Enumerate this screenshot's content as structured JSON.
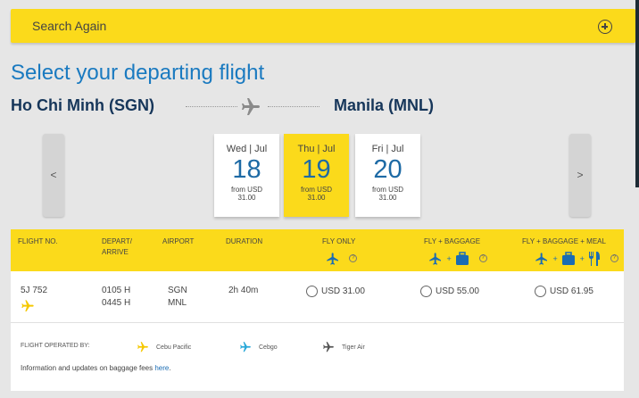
{
  "search": {
    "label": "Search Again",
    "icon": "plus-circle-icon"
  },
  "page": {
    "title": "Select your departing flight",
    "origin": "Ho Chi Minh (SGN)",
    "destination": "Manila (MNL)"
  },
  "date_nav": {
    "prev": "<",
    "next": ">"
  },
  "dates": [
    {
      "dow": "Wed | Jul",
      "day": "18",
      "price_line1": "from USD",
      "price_line2": "31.00",
      "selected": false
    },
    {
      "dow": "Thu | Jul",
      "day": "19",
      "price_line1": "from USD",
      "price_line2": "31.00",
      "selected": true
    },
    {
      "dow": "Fri | Jul",
      "day": "20",
      "price_line1": "from USD",
      "price_line2": "31.00",
      "selected": false
    }
  ],
  "table": {
    "headers": {
      "flight": "FLIGHT NO.",
      "depart_1": "DEPART/",
      "depart_2": "ARRIVE",
      "airport": "AIRPORT",
      "duration": "DURATION",
      "fly_only": "FLY ONLY",
      "fly_baggage": "FLY + BAGGAGE",
      "fly_baggage_meal": "FLY + BAGGAGE + MEAL",
      "help": "?"
    },
    "rows": [
      {
        "flight_no": "5J 752",
        "depart": "0105 H",
        "arrive": "0445 H",
        "airport_from": "SGN",
        "airport_to": "MNL",
        "duration": "2h 40m",
        "fares": [
          "USD 31.00",
          "USD 55.00",
          "USD 61.95"
        ]
      }
    ],
    "operated_by_label": "FLIGHT OPERATED BY:",
    "carriers": [
      {
        "name": "Cebu Pacific",
        "color": "#f5c800"
      },
      {
        "name": "Cebgo",
        "color": "#29a8d8"
      },
      {
        "name": "Tiger Air",
        "color": "#555555"
      }
    ],
    "info_text": "Information and updates on baggage fees ",
    "info_link": "here",
    "info_end": "."
  },
  "colors": {
    "brand_yellow": "#fbda1b",
    "title_blue": "#1a7ac0",
    "route_navy": "#16365a"
  }
}
